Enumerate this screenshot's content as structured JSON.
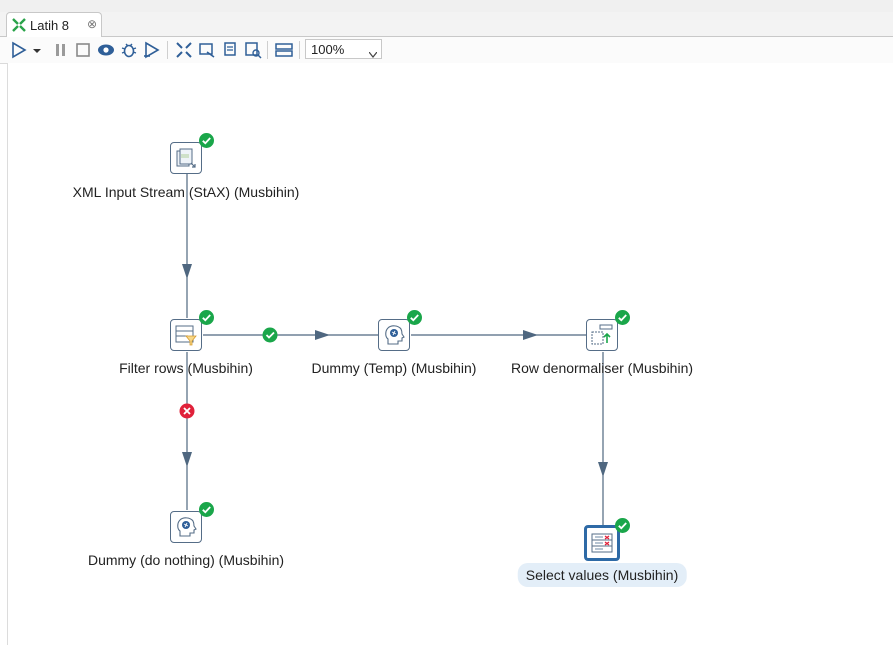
{
  "tab": {
    "title": "Latih 8",
    "close_glyph": "⊗"
  },
  "toolbar": {
    "zoom_value": "100%",
    "icons": [
      "run-icon",
      "run-options-icon",
      "pause-icon",
      "stop-icon",
      "preview-icon",
      "debug-icon",
      "replay-icon",
      "verify-icon",
      "impact-icon",
      "sql-icon",
      "explore-db-icon",
      "show-results-icon"
    ]
  },
  "steps": [
    {
      "id": "xml",
      "label": "XML Input Stream (StAX) (Musbihin)"
    },
    {
      "id": "filter",
      "label": "Filter rows (Musbihin)"
    },
    {
      "id": "dummy_temp",
      "label": "Dummy (Temp) (Musbihin)"
    },
    {
      "id": "denorm",
      "label": "Row denormaliser (Musbihin)"
    },
    {
      "id": "dummy_nothing",
      "label": "Dummy (do nothing) (Musbihin)"
    },
    {
      "id": "select",
      "label": "Select values (Musbihin)"
    }
  ],
  "colors": {
    "hop": "#4f6780",
    "ok": "#1aa64a",
    "error": "#e0213a",
    "selected": "#2e6aa6"
  }
}
